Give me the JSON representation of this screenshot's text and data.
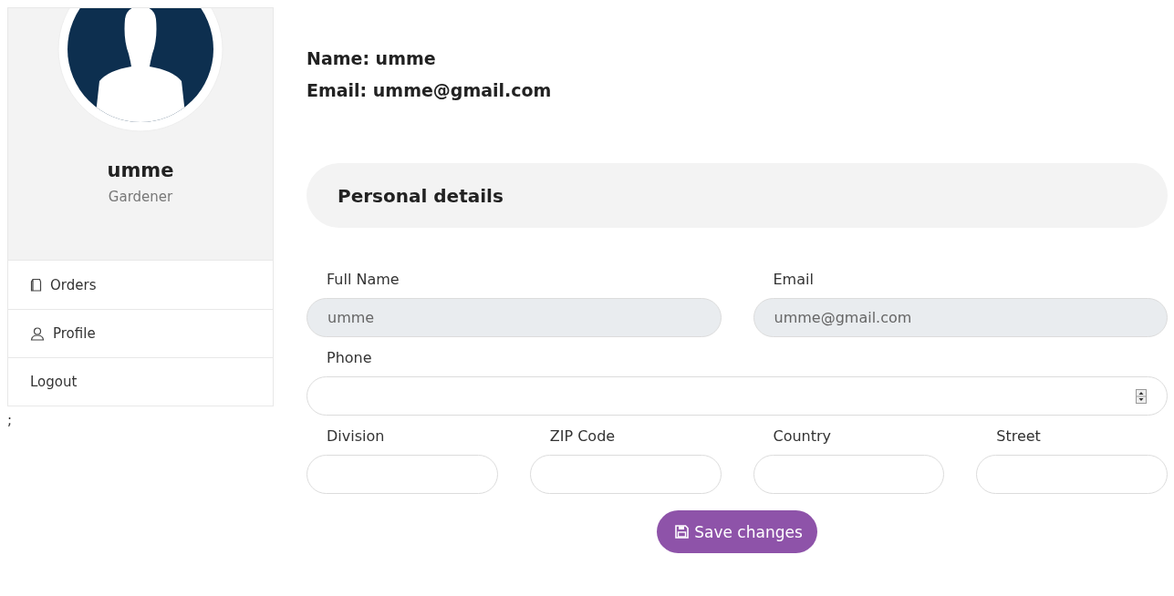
{
  "sidebar": {
    "user_name": "umme",
    "role": "Gardener",
    "menu": [
      {
        "label": "Orders",
        "kind": "bag"
      },
      {
        "label": "Profile",
        "kind": "person"
      },
      {
        "label": "Logout",
        "kind": "plain"
      }
    ]
  },
  "stray_text": ";",
  "header": {
    "name_line": "Name: umme",
    "email_line": "Email: umme@gmail.com"
  },
  "section_title": "Personal details",
  "form_rows": [
    [
      {
        "label": "Full Name",
        "value": "umme",
        "disabled": true,
        "kind": "text"
      },
      {
        "label": "Email",
        "value": "umme@gmail.com",
        "disabled": true,
        "kind": "text"
      }
    ],
    [
      {
        "label": "Phone",
        "disabled": false,
        "kind": "number"
      }
    ],
    [
      {
        "label": "Division",
        "disabled": false,
        "kind": "text"
      },
      {
        "label": "ZIP Code",
        "disabled": false,
        "kind": "text"
      },
      {
        "label": "Country",
        "disabled": false,
        "kind": "text"
      },
      {
        "label": "Street",
        "disabled": false,
        "kind": "text"
      }
    ]
  ],
  "save_button": {
    "label": "Save changes"
  }
}
